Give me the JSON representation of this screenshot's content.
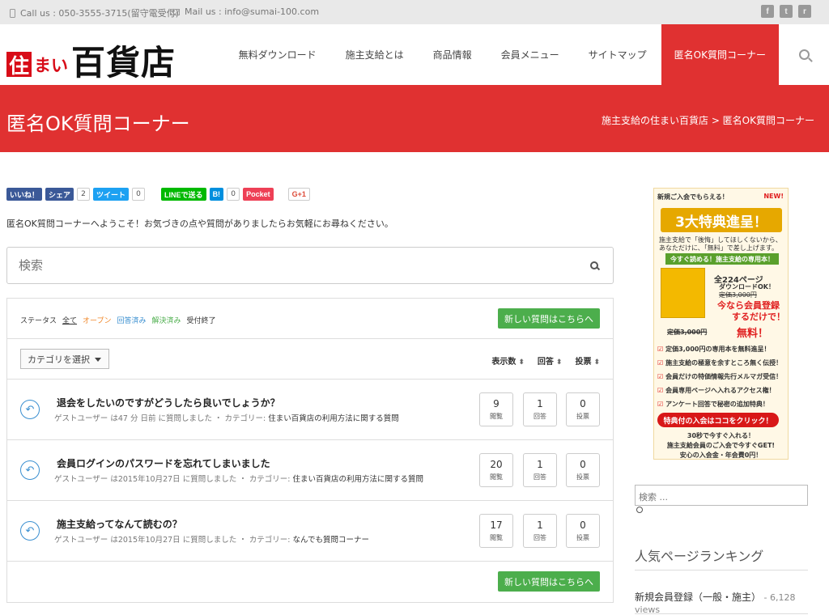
{
  "topbar": {
    "phone": "Call us : 050-3555-3715(留守電受付)",
    "mail": "Mail us : info@sumai-100.com"
  },
  "social": {
    "facebook": "f",
    "twitter": "t",
    "rss": "r"
  },
  "logo": {
    "box": "住",
    "small": "まい",
    "big": "百貨店"
  },
  "nav": [
    "無料ダウンロード",
    "施主支給とは",
    "商品情報",
    "会員メニュー",
    "サイトマップ",
    "匿名OK質問コーナー"
  ],
  "banner": {
    "title": "匿名OK質問コーナー",
    "breadcrumb": "施主支給の住まい百貨店 > 匿名OK質問コーナー"
  },
  "share": {
    "like": "いいね！",
    "share": "シェア",
    "share_count": "2",
    "tweet": "ツイート",
    "tweet_count": "0",
    "line": "LINEで送る",
    "hatena": "B!",
    "hatena_count": "0",
    "pocket": "Pocket",
    "gplus": "G+1"
  },
  "welcome": "匿名OK質問コーナーへようこそ！お気づきの点や質問がありましたらお気軽にお尋ねください。",
  "search": {
    "placeholder": "検索"
  },
  "status": {
    "label": "ステータス",
    "all": "全て",
    "open": "オープン",
    "answered": "回答済み",
    "resolved": "解決済み",
    "closed": "受付終了"
  },
  "new_question": "新しい質問はこちらへ",
  "category_select": "カテゴリを選択",
  "sort": {
    "views": "表示数",
    "answers": "回答",
    "votes": "投票"
  },
  "stat_labels": {
    "views": "閲覧",
    "answers": "回答",
    "votes": "投票"
  },
  "questions": [
    {
      "title": "退会をしたいのですがどうしたら良いでしょうか？",
      "meta": "ゲストユーザー は47 分 日前 に質問しました ・ カテゴリー: ",
      "category": "住まい百貨店の利用方法に関する質問",
      "views": "9",
      "answers": "1",
      "votes": "0"
    },
    {
      "title": "会員ログインのパスワードを忘れてしまいました",
      "meta": "ゲストユーザー は2015年10月27日 に質問しました ・ カテゴリー: ",
      "category": "住まい百貨店の利用方法に関する質問",
      "views": "20",
      "answers": "1",
      "votes": "0"
    },
    {
      "title": "施主支給ってなんて読むの？",
      "meta": "ゲストユーザー は2015年10月27日 に質問しました ・ カテゴリー: ",
      "category": "なんでも質問コーナー",
      "views": "17",
      "answers": "1",
      "votes": "0"
    }
  ],
  "ad": {
    "header": "新規ご入会でもらえる！",
    "new": "NEW!",
    "title": "3大特典進呈！",
    "line1": "施主支給で「後悔」してほしくないから、",
    "line2": "あなただけに、「無料」で差し上げます。",
    "green": "今すぐ読める！施主支給の専用本！",
    "pages": "全224ページ",
    "download": "ダウンロードOK！",
    "price_old": "定価3,000円",
    "now": "今なら会員登録",
    "now2": "するだけで！",
    "free_old": "定価3,000円",
    "free": "無料！",
    "list": [
      "定価3,000円の専用本を無料進呈！",
      "施主支給の極意を余すところ無く伝授！",
      "会員だけの特価情報先行メルマガ受信！",
      "会員専用ページへ入れるアクセス権！",
      "アンケート回答で秘密の追加特典！"
    ],
    "cta": "特典付の入会はココをクリック！",
    "foot1": "30秒で今すぐ入れる！",
    "foot2": "施主支給会員のご入会で今すぐGET!",
    "foot3": "安心の入会金・年会費0円！"
  },
  "sidebar_search": {
    "placeholder": "検索 ..."
  },
  "ranking": {
    "heading": "人気ページランキング",
    "item": "新規会員登録（一般・施主）",
    "views": " - 6,128 views"
  }
}
